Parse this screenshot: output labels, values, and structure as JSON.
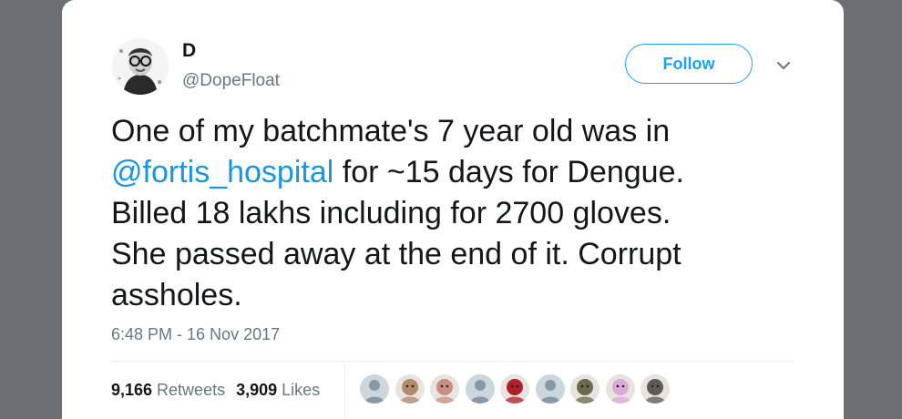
{
  "author": {
    "name": "D",
    "handle": "@DopeFloat"
  },
  "follow_label": "Follow",
  "tweet": {
    "line1": "One of my batchmate's 7 year old was in",
    "mention": "@fortis_hospital",
    "line2_rest": " for ~15 days for Dengue.",
    "line3": "Billed 18 lakhs including for 2700 gloves.",
    "line4": "She passed away at the end of it. Corrupt",
    "line5": "assholes."
  },
  "timestamp": "6:48 PM - 16 Nov 2017",
  "stats": {
    "retweets_count": "9,166",
    "retweets_label": "Retweets",
    "likes_count": "3,909",
    "likes_label": "Likes"
  },
  "likers": [
    {
      "icon": "default-avatar-icon",
      "color": "#ccd6dd"
    },
    {
      "icon": "user-photo-icon",
      "color": "#b08a6a"
    },
    {
      "icon": "user-photo-icon",
      "color": "#c99080"
    },
    {
      "icon": "default-avatar-icon",
      "color": "#ccd6dd"
    },
    {
      "icon": "user-photo-icon",
      "color": "#b0202a"
    },
    {
      "icon": "default-avatar-icon",
      "color": "#ccd6dd"
    },
    {
      "icon": "user-photo-icon",
      "color": "#6c6a4c"
    },
    {
      "icon": "user-photo-icon",
      "color": "#d9a9d8"
    },
    {
      "icon": "user-photo-icon",
      "color": "#5f5a55"
    }
  ],
  "colors": {
    "accent": "#1da1f2",
    "link": "#1b95e0",
    "text": "#14171a",
    "muted": "#657786",
    "backdrop": "#6b6f73"
  }
}
